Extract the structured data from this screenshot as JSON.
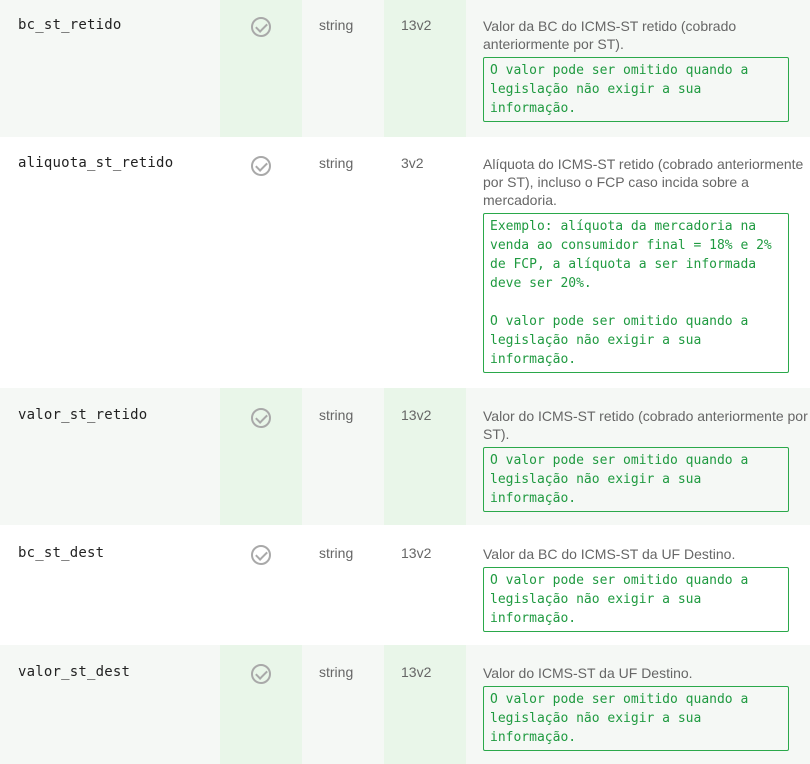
{
  "rows": [
    {
      "name": "bc_st_retido",
      "type": "string",
      "version": "13v2",
      "description": "Valor da BC do ICMS-ST retido (cobrado anteriormente por ST).",
      "notes": [
        "O valor pode ser omitido quando a legislação não exigir a sua informação."
      ]
    },
    {
      "name": "aliquota_st_retido",
      "type": "string",
      "version": "3v2",
      "description": "Alíquota do ICMS-ST retido (cobrado anteriormente por ST), incluso o FCP caso incida sobre a mercadoria.",
      "notes": [
        "Exemplo: alíquota da mercadoria na venda ao consumidor final = 18% e 2% de FCP, a alíquota a ser informada deve ser 20%.",
        "O valor pode ser omitido quando a legislação não exigir a sua informação."
      ]
    },
    {
      "name": "valor_st_retido",
      "type": "string",
      "version": "13v2",
      "description": "Valor do ICMS-ST retido (cobrado anteriormente por ST).",
      "notes": [
        "O valor pode ser omitido quando a legislação não exigir a sua informação."
      ]
    },
    {
      "name": "bc_st_dest",
      "type": "string",
      "version": "13v2",
      "description": "Valor da BC do ICMS-ST da UF Destino.",
      "notes": [
        "O valor pode ser omitido quando a legislação não exigir a sua informação."
      ]
    },
    {
      "name": "valor_st_dest",
      "type": "string",
      "version": "13v2",
      "description": "Valor do ICMS-ST da UF Destino.",
      "notes": [
        "O valor pode ser omitido quando a legislação não exigir a sua informação."
      ]
    }
  ],
  "icons": {
    "required": "check-circle-icon"
  },
  "colors": {
    "note_border": "#2aa84a",
    "note_text": "#1f9a40",
    "alt_row": "#f5f8f5",
    "alt_col": "#e9f6e9"
  }
}
